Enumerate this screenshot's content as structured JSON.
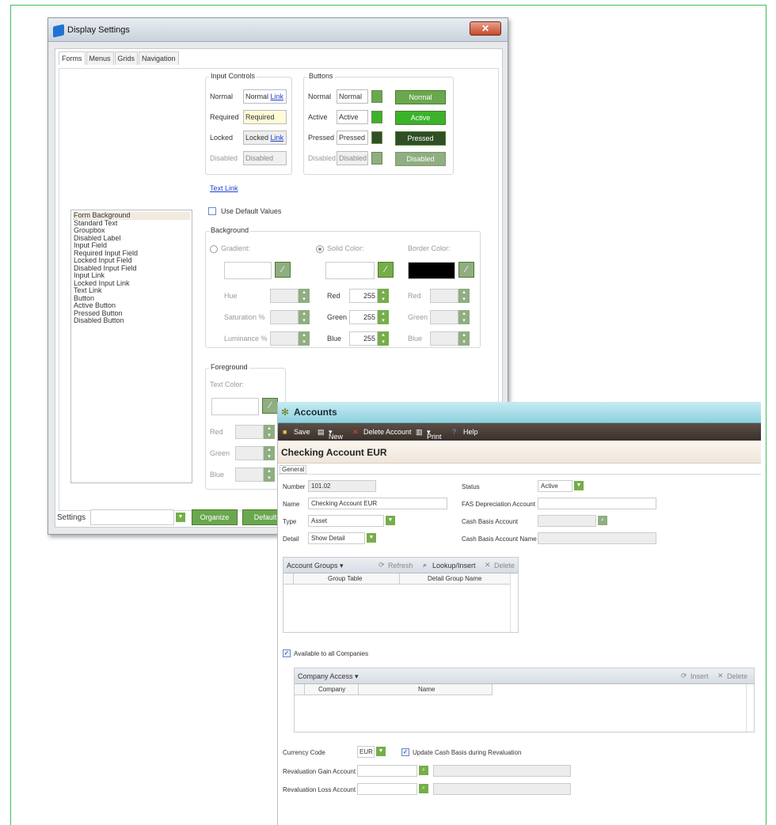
{
  "colors": {
    "frame_border": "#3fbf5a",
    "button_normal": "#6aa84f",
    "button_active": "#3cb22a",
    "button_pressed": "#2f4f24",
    "button_disabled": "#8fae82",
    "accent_green": "#76ae4a",
    "accounts_header": "#9dd8e2",
    "toolbar": "#3a302b"
  },
  "display_settings": {
    "title": "Display Settings",
    "close_icon": "close-icon",
    "tabs": [
      "Forms",
      "Menus",
      "Grids",
      "Navigation"
    ],
    "input_controls": {
      "legend": "Input Controls",
      "rows": [
        {
          "label": "Normal",
          "value": "Normal",
          "link": "Link"
        },
        {
          "label": "Required",
          "value": "Required"
        },
        {
          "label": "Locked",
          "value": "Locked",
          "link": "Link"
        },
        {
          "label": "Disabled",
          "value": "Disabled"
        }
      ]
    },
    "buttons_group": {
      "legend": "Buttons",
      "rows": [
        {
          "label": "Normal",
          "value": "Normal",
          "button": "Normal"
        },
        {
          "label": "Active",
          "value": "Active",
          "button": "Active"
        },
        {
          "label": "Pressed",
          "value": "Pressed",
          "button": "Pressed"
        },
        {
          "label": "Disabled",
          "value": "Disabled",
          "button": "Disabled"
        }
      ]
    },
    "text_link": "Text Link",
    "use_default_values": "Use Default Values",
    "element_list": [
      "Form Background",
      "Standard Text",
      "Groupbox",
      "Disabled Label",
      "Input Field",
      "Required Input Field",
      "Locked Input Field",
      "Disabled Input Field",
      "Input Link",
      "Locked Input Link",
      "Text Link",
      "Button",
      "Active Button",
      "Pressed Button",
      "Disabled Button"
    ],
    "background": {
      "legend": "Background",
      "gradient": "Gradient:",
      "solid_color": "Solid Color:",
      "border_color": "Border Color:",
      "hue": "Hue",
      "saturation": "Saturation %",
      "luminance": "Luminance %",
      "red": "Red",
      "green": "Green",
      "blue": "Blue",
      "red_value": "255",
      "green_value": "255",
      "blue_value": "255"
    },
    "foreground": {
      "legend": "Foreground",
      "text_color": "Text Color:",
      "red": "Red",
      "green": "Green",
      "blue": "Blue"
    },
    "settings_label": "Settings",
    "organize_button": "Organize",
    "default_button": "Default"
  },
  "accounts": {
    "title": "Accounts",
    "toolbar": {
      "save": "Save",
      "new": "New",
      "delete_account": "Delete Account",
      "print": "Print",
      "help": "Help"
    },
    "heading": "Checking Account EUR",
    "tab_general": "General",
    "form": {
      "number_label": "Number",
      "number_value": "101.02",
      "name_label": "Name",
      "name_value": "Checking Account EUR",
      "type_label": "Type",
      "type_value": "Asset",
      "detail_label": "Detail",
      "detail_value": "Show Detail",
      "status_label": "Status",
      "status_value": "Active",
      "fas_label": "FAS Depreciation Account",
      "cash_basis_label": "Cash Basis Account",
      "cash_basis_name_label": "Cash Basis Account Name"
    },
    "account_groups": {
      "title": "Account Groups",
      "refresh": "Refresh",
      "lookup_insert": "Lookup/Insert",
      "delete": "Delete",
      "columns": [
        "Group Table",
        "Detail Group Name"
      ]
    },
    "available_all_companies": "Available to all Companies",
    "company_access": {
      "title": "Company Access",
      "insert": "Insert",
      "delete": "Delete",
      "columns": [
        "Company",
        "Name"
      ]
    },
    "currency_code_label": "Currency Code",
    "currency_code_value": "EUR",
    "update_cash_basis": "Update Cash Basis during Revaluation",
    "revaluation_gain": "Revaluation Gain Account",
    "revaluation_loss": "Revaluation Loss Account"
  }
}
